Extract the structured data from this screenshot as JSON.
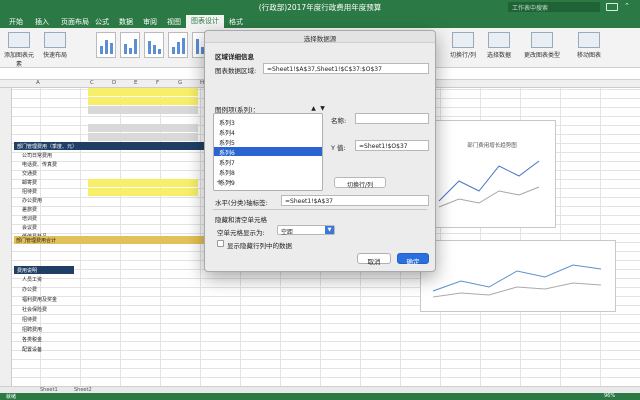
{
  "window": {
    "title": "(行政部)2017年度行政费用年度预算",
    "search_placeholder": "工作表中搜索"
  },
  "tabs": [
    "开始",
    "插入",
    "页面布局",
    "公式",
    "数据",
    "审阅",
    "视图",
    "图表设计",
    "格式"
  ],
  "active_tab": "图表设计",
  "ribbon": {
    "add_element": "添加图表元素",
    "quick_layout": "快速布局",
    "switch_row_col": "切换行/列",
    "select_data": "选择数据",
    "change_type": "更改图表类型",
    "move_chart": "移动图表"
  },
  "sheet": {
    "section1": "部门管理费用（季度、元）",
    "section2": "费用说明",
    "row_labels": [
      "公司日常费用",
      "电话费、传真费",
      "交通费",
      "邮寄费",
      "招待费",
      "办公费用",
      "差旅费",
      "培训费",
      "会议费",
      "低值易耗品",
      "部门管理费用合计"
    ],
    "notes": [
      "人员工资",
      "办公费",
      "福利费用及奖金",
      "社会保险费",
      "招待费",
      "招聘费用",
      "各类税金",
      "配置设备"
    ]
  },
  "bg_chart": {
    "title": "部门费用增长趋势图"
  },
  "sheet_tabs": [
    "Sheet1",
    "Sheet2"
  ],
  "status": {
    "ready": "就绪",
    "zoom": "96%"
  },
  "dialog": {
    "title": "选择数据源",
    "region_title": "区域详细信息",
    "data_range_label": "图表数据区域:",
    "data_range_value": "=Sheet1!$A$37,Sheet1!$C$37:$O$37",
    "series_label": "图例项(系列)：",
    "series": [
      "系列3",
      "系列4",
      "系列5",
      "系列6",
      "系列7",
      "系列8",
      "系列9"
    ],
    "selected_series": "系列6",
    "add": "+",
    "remove": "−",
    "switch_button": "切换行/列",
    "name_label": "名称:",
    "yvalue_label": "Y 值:",
    "yvalue_value": "=Sheet1!$O$37",
    "xaxis_label": "水平(分类)轴标签:",
    "xaxis_value": "=Sheet1!$A$37",
    "hidden_title": "隐藏和清空单元格",
    "empty_cells_label": "空单元格显示为:",
    "empty_cells_value": "空距",
    "show_hidden_label": "显示隐藏行列中的数据",
    "cancel": "取消",
    "ok": "确定"
  }
}
